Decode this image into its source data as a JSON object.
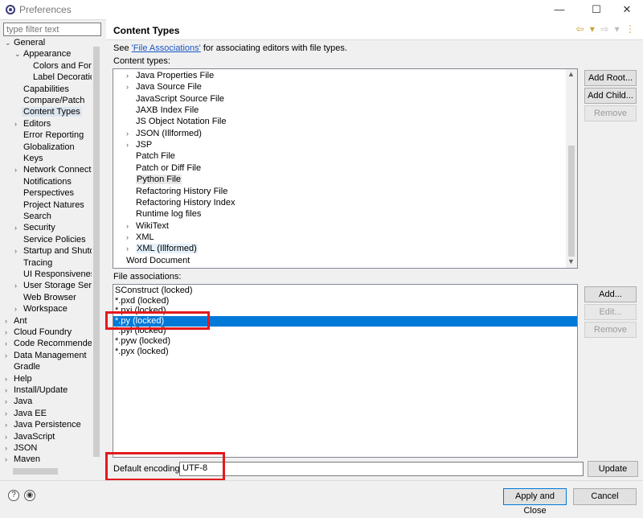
{
  "window": {
    "title": "Preferences",
    "minimize_glyph": "—",
    "maximize_glyph": "☐",
    "close_glyph": "✕"
  },
  "sidebar": {
    "filter_placeholder": "type filter text",
    "items": [
      {
        "label": "General",
        "level": 0,
        "chevron": "⌄"
      },
      {
        "label": "Appearance",
        "level": 1,
        "chevron": "⌄"
      },
      {
        "label": "Colors and Fonts",
        "level": 2,
        "chevron": ""
      },
      {
        "label": "Label Decorations",
        "level": 2,
        "chevron": ""
      },
      {
        "label": "Capabilities",
        "level": 1,
        "chevron": ""
      },
      {
        "label": "Compare/Patch",
        "level": 1,
        "chevron": ""
      },
      {
        "label": "Content Types",
        "level": 1,
        "chevron": "",
        "selected": true
      },
      {
        "label": "Editors",
        "level": 1,
        "chevron": "›"
      },
      {
        "label": "Error Reporting",
        "level": 1,
        "chevron": ""
      },
      {
        "label": "Globalization",
        "level": 1,
        "chevron": ""
      },
      {
        "label": "Keys",
        "level": 1,
        "chevron": ""
      },
      {
        "label": "Network Connections",
        "level": 1,
        "chevron": "›"
      },
      {
        "label": "Notifications",
        "level": 1,
        "chevron": ""
      },
      {
        "label": "Perspectives",
        "level": 1,
        "chevron": ""
      },
      {
        "label": "Project Natures",
        "level": 1,
        "chevron": ""
      },
      {
        "label": "Search",
        "level": 1,
        "chevron": ""
      },
      {
        "label": "Security",
        "level": 1,
        "chevron": "›"
      },
      {
        "label": "Service Policies",
        "level": 1,
        "chevron": ""
      },
      {
        "label": "Startup and Shutdown",
        "level": 1,
        "chevron": "›"
      },
      {
        "label": "Tracing",
        "level": 1,
        "chevron": ""
      },
      {
        "label": "UI Responsiveness",
        "level": 1,
        "chevron": ""
      },
      {
        "label": "User Storage Service",
        "level": 1,
        "chevron": "›"
      },
      {
        "label": "Web Browser",
        "level": 1,
        "chevron": ""
      },
      {
        "label": "Workspace",
        "level": 1,
        "chevron": "›"
      },
      {
        "label": "Ant",
        "level": 0,
        "chevron": "›"
      },
      {
        "label": "Cloud Foundry",
        "level": 0,
        "chevron": "›"
      },
      {
        "label": "Code Recommenders",
        "level": 0,
        "chevron": "›"
      },
      {
        "label": "Data Management",
        "level": 0,
        "chevron": "›"
      },
      {
        "label": "Gradle",
        "level": 0,
        "chevron": ""
      },
      {
        "label": "Help",
        "level": 0,
        "chevron": "›"
      },
      {
        "label": "Install/Update",
        "level": 0,
        "chevron": "›"
      },
      {
        "label": "Java",
        "level": 0,
        "chevron": "›"
      },
      {
        "label": "Java EE",
        "level": 0,
        "chevron": "›"
      },
      {
        "label": "Java Persistence",
        "level": 0,
        "chevron": "›"
      },
      {
        "label": "JavaScript",
        "level": 0,
        "chevron": "›"
      },
      {
        "label": "JSON",
        "level": 0,
        "chevron": "›"
      },
      {
        "label": "Maven",
        "level": 0,
        "chevron": "›"
      }
    ]
  },
  "main": {
    "title": "Content Types",
    "description_prefix": "See ",
    "description_link": "'File Associations'",
    "description_suffix": " for associating editors with file types.",
    "content_types_label": "Content types:",
    "content_types": [
      {
        "label": "Java Properties File",
        "chevron": "›",
        "indent": 1
      },
      {
        "label": "Java Source File",
        "chevron": "›",
        "indent": 1
      },
      {
        "label": "JavaScript Source File",
        "chevron": "",
        "indent": 1
      },
      {
        "label": "JAXB Index File",
        "chevron": "",
        "indent": 1
      },
      {
        "label": "JS Object Notation File",
        "chevron": "",
        "indent": 1
      },
      {
        "label": "JSON (Illformed)",
        "chevron": "›",
        "indent": 1
      },
      {
        "label": "JSP",
        "chevron": "›",
        "indent": 1
      },
      {
        "label": "Patch File",
        "chevron": "",
        "indent": 1
      },
      {
        "label": "Patch or Diff File",
        "chevron": "",
        "indent": 1
      },
      {
        "label": "Python File",
        "chevron": "",
        "indent": 1,
        "selected": true
      },
      {
        "label": "Refactoring History File",
        "chevron": "",
        "indent": 1
      },
      {
        "label": "Refactoring History Index",
        "chevron": "",
        "indent": 1
      },
      {
        "label": "Runtime log files",
        "chevron": "",
        "indent": 1
      },
      {
        "label": "WikiText",
        "chevron": "›",
        "indent": 1
      },
      {
        "label": "XML",
        "chevron": "›",
        "indent": 1
      },
      {
        "label": "XML (Illformed)",
        "chevron": "›",
        "indent": 1,
        "highlight": true
      },
      {
        "label": "Word Document",
        "chevron": "",
        "indent": 0
      }
    ],
    "add_root_label": "Add Root...",
    "add_child_label": "Add Child...",
    "remove_type_label": "Remove",
    "file_assoc_label": "File associations:",
    "file_associations": [
      {
        "label": "SConstruct (locked)"
      },
      {
        "label": "*.pxd (locked)"
      },
      {
        "label": "*.pxi (locked)"
      },
      {
        "label": "*.py (locked)",
        "selected": true
      },
      {
        "label": "*.pyi (locked)"
      },
      {
        "label": "*.pyw (locked)"
      },
      {
        "label": "*.pyx (locked)"
      }
    ],
    "add_assoc_label": "Add...",
    "edit_assoc_label": "Edit...",
    "remove_assoc_label": "Remove",
    "encoding_label": "Default encoding:",
    "encoding_value": "UTF-8",
    "update_label": "Update"
  },
  "footer": {
    "help_glyph": "?",
    "import_glyph": "◉",
    "apply_close_label": "Apply and Close",
    "cancel_label": "Cancel"
  },
  "colors": {
    "selection": "#0078d7",
    "highlight_box": "#e3191d",
    "link": "#1a56c2"
  }
}
